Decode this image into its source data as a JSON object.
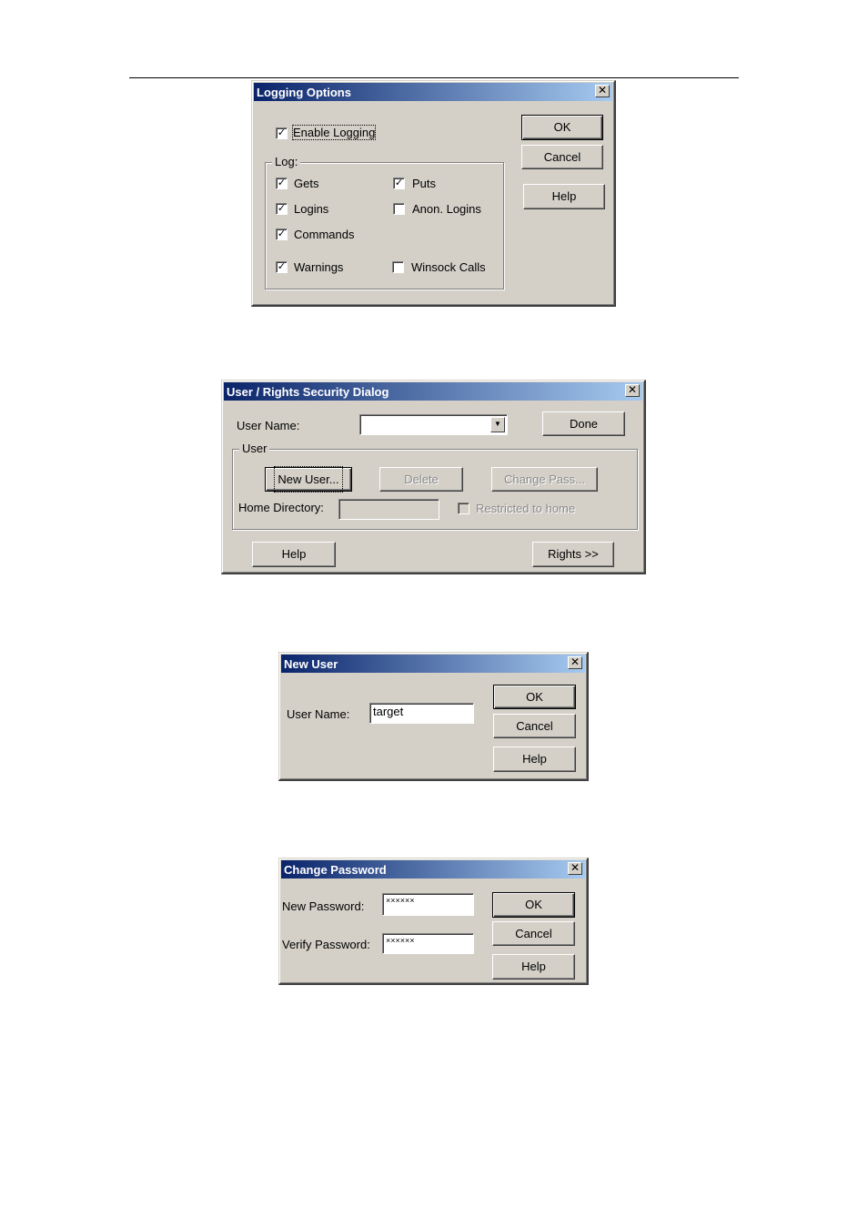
{
  "logging_options": {
    "title": "Logging Options",
    "close_glyph": "✕",
    "enable_logging": {
      "label": "Enable Logging",
      "checked": true
    },
    "log_group_label": "Log:",
    "checkboxes": [
      {
        "label": "Gets",
        "checked": true
      },
      {
        "label": "Puts",
        "checked": true
      },
      {
        "label": "Logins",
        "checked": true
      },
      {
        "label": "Anon. Logins",
        "checked": false
      },
      {
        "label": "Commands",
        "checked": true
      },
      {
        "label": "Warnings",
        "checked": true
      },
      {
        "label": "Winsock Calls",
        "checked": false
      }
    ],
    "buttons": {
      "ok": "OK",
      "cancel": "Cancel",
      "help": "Help"
    }
  },
  "user_rights_dialog": {
    "title": "User / Rights Security Dialog",
    "close_glyph": "✕",
    "user_name_label": "User Name:",
    "user_name_value": "",
    "done_button": "Done",
    "user_group_label": "User",
    "new_user_button": "New User...",
    "delete_button": "Delete",
    "change_pass_button": "Change Pass...",
    "home_directory_label": "Home Directory:",
    "home_directory_value": "",
    "restricted_label": "Restricted to home",
    "help_button": "Help",
    "rights_button": "Rights >>"
  },
  "new_user": {
    "title": "New User",
    "close_glyph": "✕",
    "user_name_label": "User Name:",
    "user_name_value": "target",
    "buttons": {
      "ok": "OK",
      "cancel": "Cancel",
      "help": "Help"
    }
  },
  "change_password": {
    "title": "Change Password",
    "close_glyph": "✕",
    "new_password_label": "New Password:",
    "new_password_value": "××××××",
    "verify_password_label": "Verify Password:",
    "verify_password_value": "××××××",
    "buttons": {
      "ok": "OK",
      "cancel": "Cancel",
      "help": "Help"
    }
  }
}
